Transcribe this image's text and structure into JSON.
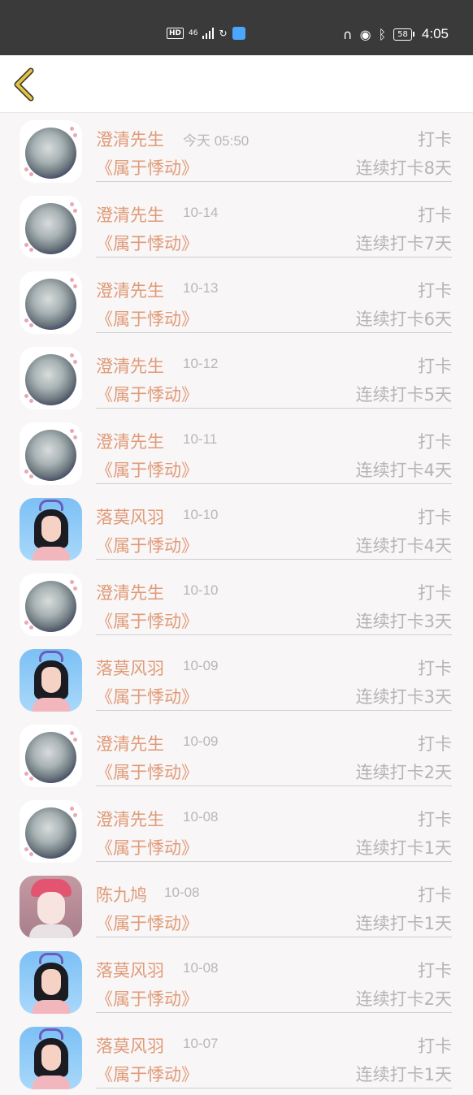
{
  "status_bar": {
    "hd": "HD",
    "network": "46",
    "battery": "58",
    "time": "4:05"
  },
  "header": {
    "back_icon": "chevron-left-icon"
  },
  "checkins": [
    {
      "avatar": "moon",
      "name": "澄清先生",
      "time": "今天 05:50",
      "action": "打卡",
      "title": "《属于悸动》",
      "streak": "连续打卡8天"
    },
    {
      "avatar": "moon",
      "name": "澄清先生",
      "time": "10-14",
      "action": "打卡",
      "title": "《属于悸动》",
      "streak": "连续打卡7天"
    },
    {
      "avatar": "moon",
      "name": "澄清先生",
      "time": "10-13",
      "action": "打卡",
      "title": "《属于悸动》",
      "streak": "连续打卡6天"
    },
    {
      "avatar": "moon",
      "name": "澄清先生",
      "time": "10-12",
      "action": "打卡",
      "title": "《属于悸动》",
      "streak": "连续打卡5天"
    },
    {
      "avatar": "moon",
      "name": "澄清先生",
      "time": "10-11",
      "action": "打卡",
      "title": "《属于悸动》",
      "streak": "连续打卡4天"
    },
    {
      "avatar": "girl",
      "name": "落莫风羽",
      "time": "10-10",
      "action": "打卡",
      "title": "《属于悸动》",
      "streak": "连续打卡4天"
    },
    {
      "avatar": "moon",
      "name": "澄清先生",
      "time": "10-10",
      "action": "打卡",
      "title": "《属于悸动》",
      "streak": "连续打卡3天"
    },
    {
      "avatar": "girl",
      "name": "落莫风羽",
      "time": "10-09",
      "action": "打卡",
      "title": "《属于悸动》",
      "streak": "连续打卡3天"
    },
    {
      "avatar": "moon",
      "name": "澄清先生",
      "time": "10-09",
      "action": "打卡",
      "title": "《属于悸动》",
      "streak": "连续打卡2天"
    },
    {
      "avatar": "moon",
      "name": "澄清先生",
      "time": "10-08",
      "action": "打卡",
      "title": "《属于悸动》",
      "streak": "连续打卡1天"
    },
    {
      "avatar": "pink",
      "name": "陈九鸠",
      "time": "10-08",
      "action": "打卡",
      "title": "《属于悸动》",
      "streak": "连续打卡1天"
    },
    {
      "avatar": "girl",
      "name": "落莫风羽",
      "time": "10-08",
      "action": "打卡",
      "title": "《属于悸动》",
      "streak": "连续打卡2天"
    },
    {
      "avatar": "girl",
      "name": "落莫风羽",
      "time": "10-07",
      "action": "打卡",
      "title": "《属于悸动》",
      "streak": "连续打卡1天"
    }
  ],
  "colors": {
    "accent": "#e09a78",
    "muted": "#b5b5b5",
    "status_bar": "#3a3a3a",
    "back_icon": "#e0c24a"
  }
}
